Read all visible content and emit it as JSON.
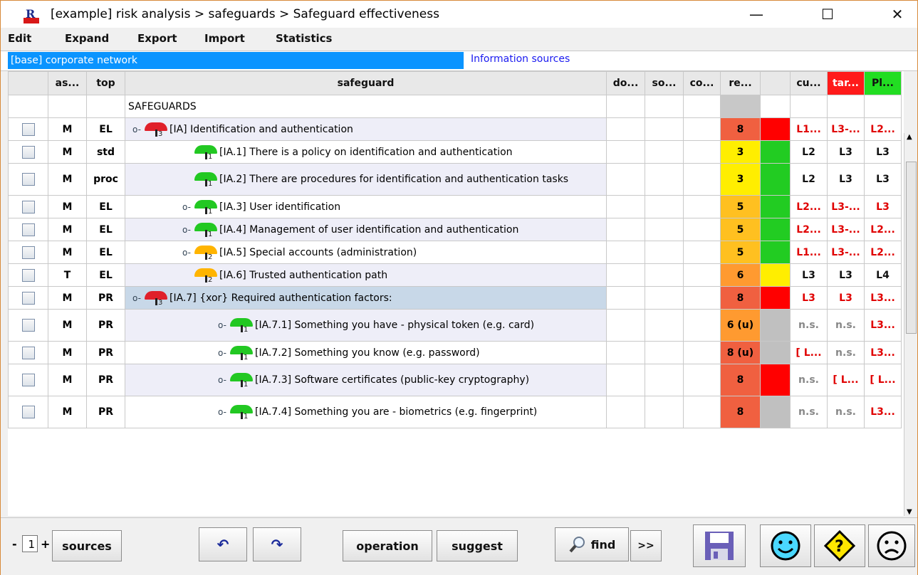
{
  "window": {
    "title": "[example] risk analysis > safeguards > Safeguard effectiveness",
    "minimize": "—",
    "maximize": "☐",
    "close": "✕"
  },
  "menu": [
    "Edit",
    "Expand",
    "Export",
    "Import",
    "Statistics"
  ],
  "context": {
    "base": "[base] corporate network",
    "sources": "Information sources"
  },
  "columns": [
    "as...",
    "top",
    "safeguard",
    "do...",
    "so...",
    "co...",
    "re...",
    "",
    "cu...",
    "tar...",
    "Pl..."
  ],
  "header_colors": {
    "tar": "#ff1a1a",
    "pl": "#22dd22"
  },
  "section_label": "SAFEGUARDS",
  "rows": [
    {
      "as": "M",
      "top": "EL",
      "level": 0,
      "key": "⚲",
      "umb": "red",
      "num": "3",
      "text": "[IA] Identification and authentication",
      "re": "8",
      "re_color": "#f06040",
      "ind": "#ff0000",
      "cu": "L1...",
      "tar": "L3-...",
      "pl": "L2...",
      "lv": [
        "red",
        "red",
        "red"
      ]
    },
    {
      "as": "M",
      "top": "std",
      "level": 1,
      "key": "",
      "umb": "green",
      "num": "1",
      "text": "[IA.1] There is a policy on identification and authentication",
      "re": "3",
      "re_color": "#ffee00",
      "ind": "#22cc22",
      "cu": "L2",
      "tar": "L3",
      "pl": "L3",
      "lv": [
        "blk",
        "blk",
        "blk"
      ]
    },
    {
      "as": "M",
      "top": "proc",
      "level": 1,
      "key": "",
      "umb": "green",
      "num": "1",
      "text": "[IA.2] There are procedures for identification and authentication tasks",
      "re": "3",
      "re_color": "#ffee00",
      "ind": "#22cc22",
      "cu": "L2",
      "tar": "L3",
      "pl": "L3",
      "lv": [
        "blk",
        "blk",
        "blk"
      ],
      "tall": true
    },
    {
      "as": "M",
      "top": "EL",
      "level": 1,
      "key": "⚲",
      "umb": "green",
      "num": "1",
      "text": "[IA.3] User identification",
      "re": "5",
      "re_color": "#ffc020",
      "ind": "#22cc22",
      "cu": "L2...",
      "tar": "L3-...",
      "pl": "L3",
      "lv": [
        "red",
        "red",
        "red"
      ]
    },
    {
      "as": "M",
      "top": "EL",
      "level": 1,
      "key": "⚲",
      "umb": "green",
      "num": "1",
      "text": "[IA.4] Management of user identification and authentication",
      "re": "5",
      "re_color": "#ffc020",
      "ind": "#22cc22",
      "cu": "L2...",
      "tar": "L3-...",
      "pl": "L2...",
      "lv": [
        "red",
        "red",
        "red"
      ]
    },
    {
      "as": "M",
      "top": "EL",
      "level": 1,
      "key": "⚲",
      "umb": "orange",
      "num": "2",
      "text": "[IA.5] Special accounts (administration)",
      "re": "5",
      "re_color": "#ffc020",
      "ind": "#22cc22",
      "cu": "L1...",
      "tar": "L3-...",
      "pl": "L2...",
      "lv": [
        "red",
        "red",
        "red"
      ]
    },
    {
      "as": "T",
      "top": "EL",
      "level": 1,
      "key": "",
      "umb": "orange",
      "num": "2",
      "text": "[IA.6] Trusted authentication path",
      "re": "6",
      "re_color": "#ff9a30",
      "ind": "#ffee00",
      "cu": "L3",
      "tar": "L3",
      "pl": "L4",
      "lv": [
        "blk",
        "blk",
        "blk"
      ]
    },
    {
      "as": "M",
      "top": "PR",
      "level": 0,
      "key": "⚲",
      "umb": "red",
      "num": "3",
      "text": "[IA.7] {xor} Required authentication factors:",
      "re": "8",
      "re_color": "#f06040",
      "ind": "#ff0000",
      "cu": "L3",
      "tar": "L3",
      "pl": "L3...",
      "lv": [
        "red",
        "red",
        "red"
      ],
      "selected": true
    },
    {
      "as": "M",
      "top": "PR",
      "level": 2,
      "key": "⚲",
      "umb": "green",
      "num": "1",
      "text": "[IA.7.1] Something you have - physical token (e.g. card)",
      "re": "6 (u)",
      "re_color": "#ff9a30",
      "ind": "#c0c0c0",
      "cu": "n.s.",
      "tar": "n.s.",
      "pl": "L3...",
      "lv": [
        "gray",
        "gray",
        "red"
      ],
      "tall": true
    },
    {
      "as": "M",
      "top": "PR",
      "level": 2,
      "key": "⚲",
      "umb": "green",
      "num": "1",
      "text": "[IA.7.2] Something you know (e.g. password)",
      "re": "8 (u)",
      "re_color": "#f06040",
      "ind": "#c0c0c0",
      "cu": "[ L...",
      "tar": "n.s.",
      "pl": "L3...",
      "lv": [
        "red",
        "gray",
        "red"
      ]
    },
    {
      "as": "M",
      "top": "PR",
      "level": 2,
      "key": "⚲",
      "umb": "green",
      "num": "1",
      "text": "[IA.7.3] Software certificates (public-key cryptography)",
      "re": "8",
      "re_color": "#f06040",
      "ind": "#ff0000",
      "cu": "n.s.",
      "tar": "[ L...",
      "pl": "[ L...",
      "lv": [
        "gray",
        "red",
        "red"
      ],
      "tall": true
    },
    {
      "as": "M",
      "top": "PR",
      "level": 2,
      "key": "⚲",
      "umb": "green",
      "num": "1",
      "text": "[IA.7.4] Something you are - biometrics (e.g. fingerprint)",
      "re": "8",
      "re_color": "#f06040",
      "ind": "#c0c0c0",
      "cu": "n.s.",
      "tar": "n.s.",
      "pl": "L3...",
      "lv": [
        "gray",
        "gray",
        "red"
      ],
      "tall": true
    }
  ],
  "bottom": {
    "minus": "-",
    "page": "1",
    "plus": "+",
    "sources": "sources",
    "undo": "↶",
    "redo": "↷",
    "operation": "operation",
    "suggest": "suggest",
    "find": "find",
    "more": ">>"
  },
  "icons": [
    "app-icon",
    "key-icon",
    "umbrella-icon",
    "magnifier-icon",
    "save-icon",
    "smiley-happy-icon",
    "question-diamond-icon",
    "smiley-sad-icon"
  ]
}
